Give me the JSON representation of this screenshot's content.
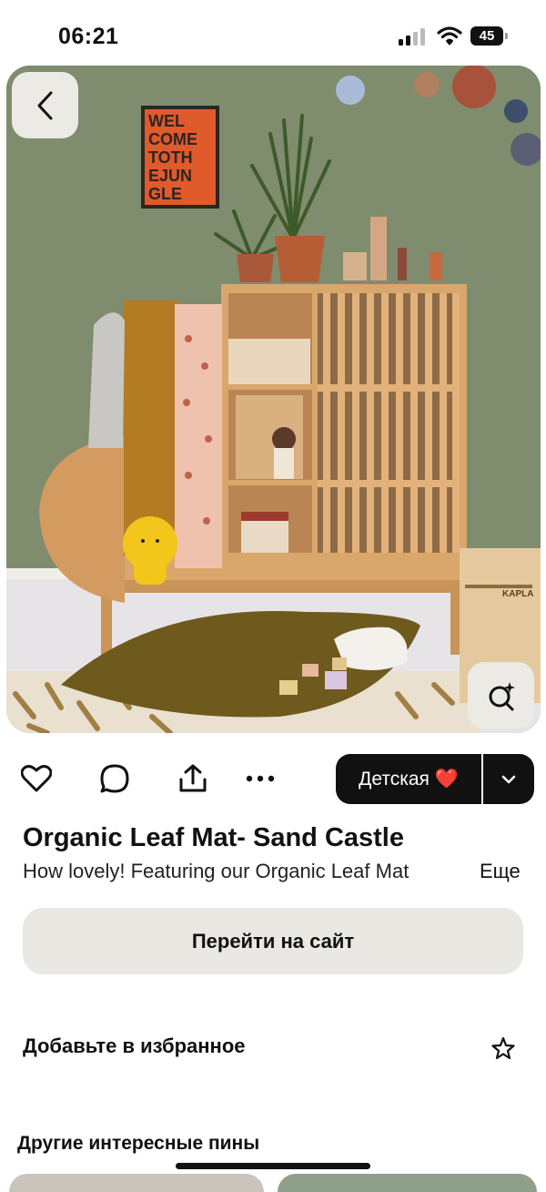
{
  "status_bar": {
    "time": "06:21",
    "battery": "45"
  },
  "hero": {
    "poster_text": [
      "WEL",
      "COME",
      "TOTH",
      "EJUN",
      "GLE"
    ],
    "box_label": "KAPLA"
  },
  "actions": {
    "board_label": "Детская ❤️"
  },
  "pin": {
    "title": "Organic Leaf Mat- Sand Castle",
    "description": "How lovely! Featuring our Organic Leaf Mat",
    "more_label": "Еще"
  },
  "visit_button_label": "Перейти на сайт",
  "favorites_label": "Добавьте в избранное",
  "other_pins_label": "Другие интересные пины",
  "colors": {
    "wall": "#7f8c6e",
    "button_gray": "#e9e8e3",
    "board_button": "#111111",
    "mat": "#6f5a1e",
    "wood": "#d9a66c"
  }
}
